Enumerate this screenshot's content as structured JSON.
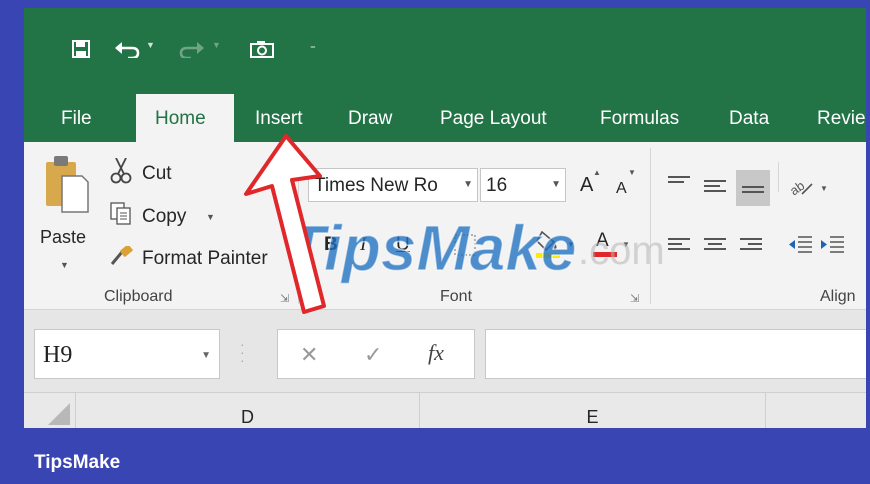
{
  "quick_access": {
    "save_icon": "save-icon",
    "undo_icon": "undo-icon",
    "redo_icon": "redo-icon",
    "camera_icon": "camera-icon",
    "customize_icon": "customize-qat-icon"
  },
  "tabs": [
    {
      "label": "File"
    },
    {
      "label": "Home"
    },
    {
      "label": "Insert"
    },
    {
      "label": "Draw"
    },
    {
      "label": "Page Layout"
    },
    {
      "label": "Formulas"
    },
    {
      "label": "Data"
    },
    {
      "label": "Revie"
    }
  ],
  "clipboard": {
    "paste_label": "Paste",
    "cut_label": "Cut",
    "copy_label": "Copy",
    "format_painter_label": "Format Painter",
    "group_label": "Clipboard"
  },
  "font": {
    "font_name": "Times New Ro",
    "font_size": "16",
    "group_label": "Font",
    "grow_label": "A",
    "shrink_label": "A",
    "bold_label": "B",
    "italic_label": "I",
    "underline_label": "U",
    "font_color_label": "A"
  },
  "alignment": {
    "group_label": "Align"
  },
  "formula_bar": {
    "name_box": "H9",
    "cancel_symbol": "✕",
    "enter_symbol": "✓",
    "fx_label": "fx",
    "formula_value": ""
  },
  "columns": [
    "D",
    "E"
  ],
  "watermark": {
    "brand": "TipsMake",
    "suffix": ".com"
  },
  "footer": {
    "brand": "TipsMake"
  },
  "colors": {
    "excel_green": "#227447",
    "frame_blue": "#3a45b4",
    "arrow_red": "#e0282a",
    "watermark_blue": "#1d6fbf"
  }
}
